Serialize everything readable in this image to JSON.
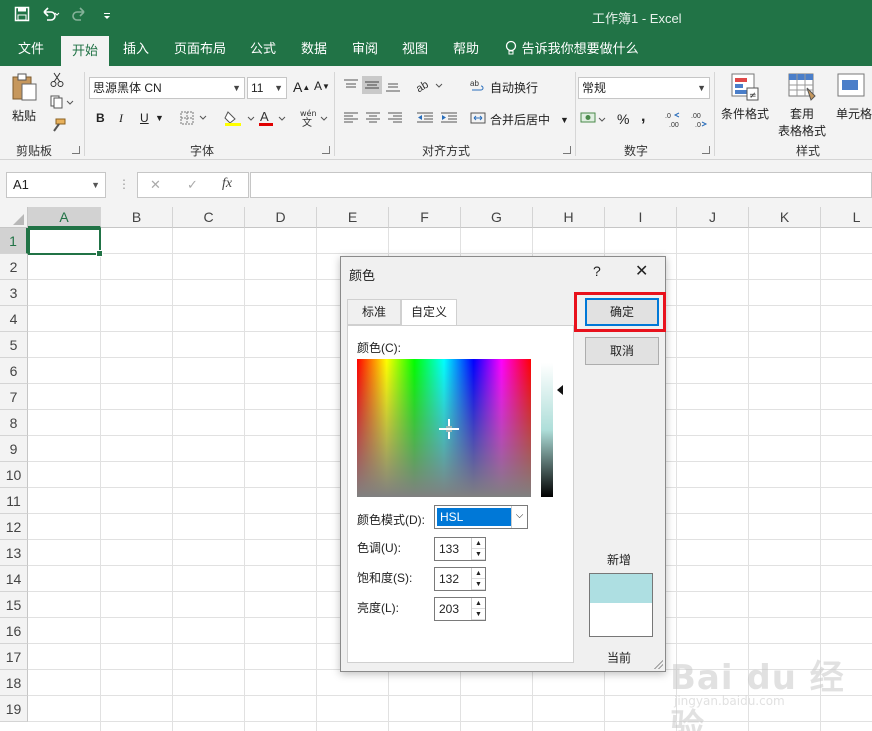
{
  "window": {
    "title": "工作簿1  -  Excel"
  },
  "colors": {
    "accent": "#217346",
    "dialog_highlight": "#e8111c",
    "selection_blue": "#0078d7",
    "new_color": "#aedfe2"
  },
  "ribbon_tabs": [
    "文件",
    "开始",
    "插入",
    "页面布局",
    "公式",
    "数据",
    "审阅",
    "视图",
    "帮助"
  ],
  "tell_me": "告诉我你想要做什么",
  "ribbon": {
    "paste": "粘贴",
    "clipboard_group": "剪贴板",
    "font_name": "思源黑体 CN",
    "font_size": "11",
    "font_group": "字体",
    "wrap_text": "自动换行",
    "merge_center": "合并后居中",
    "align_group": "对齐方式",
    "number_format": "常规",
    "number_group": "数字",
    "conditional_format": "条件格式",
    "format_table_1": "套用",
    "format_table_2": "表格格式",
    "cell_styles": "单元格",
    "styles_group": "样式",
    "bold": "B",
    "italic": "I",
    "underline": "U",
    "percent": "%",
    "comma": ","
  },
  "formula_bar": {
    "name_box": "A1",
    "fx": "fx",
    "cancel": "✕",
    "enter": "✓",
    "value": ""
  },
  "grid": {
    "columns": [
      "A",
      "B",
      "C",
      "D",
      "E",
      "F",
      "G",
      "H",
      "I",
      "J",
      "K",
      "L"
    ],
    "rows": [
      "1",
      "2",
      "3",
      "4",
      "5",
      "6",
      "7",
      "8",
      "9",
      "10",
      "11",
      "12",
      "13",
      "14",
      "15",
      "16",
      "17",
      "18",
      "19"
    ],
    "active_cell": "A1"
  },
  "dialog": {
    "title": "颜色",
    "help": "?",
    "close": "✕",
    "tabs": [
      "标准",
      "自定义"
    ],
    "active_tab": "自定义",
    "colors_label": "颜色(C):",
    "color_mode_label": "颜色模式(D):",
    "color_mode_value": "HSL",
    "hue_label": "色调(U):",
    "hue_value": "133",
    "saturation_label": "饱和度(S):",
    "saturation_value": "132",
    "luminance_label": "亮度(L):",
    "luminance_value": "203",
    "ok": "确定",
    "cancel": "取消",
    "new_label": "新增",
    "current_label": "当前"
  },
  "watermark": {
    "main": "Bai du 经验",
    "sub": "jingyan.baidu.com"
  }
}
